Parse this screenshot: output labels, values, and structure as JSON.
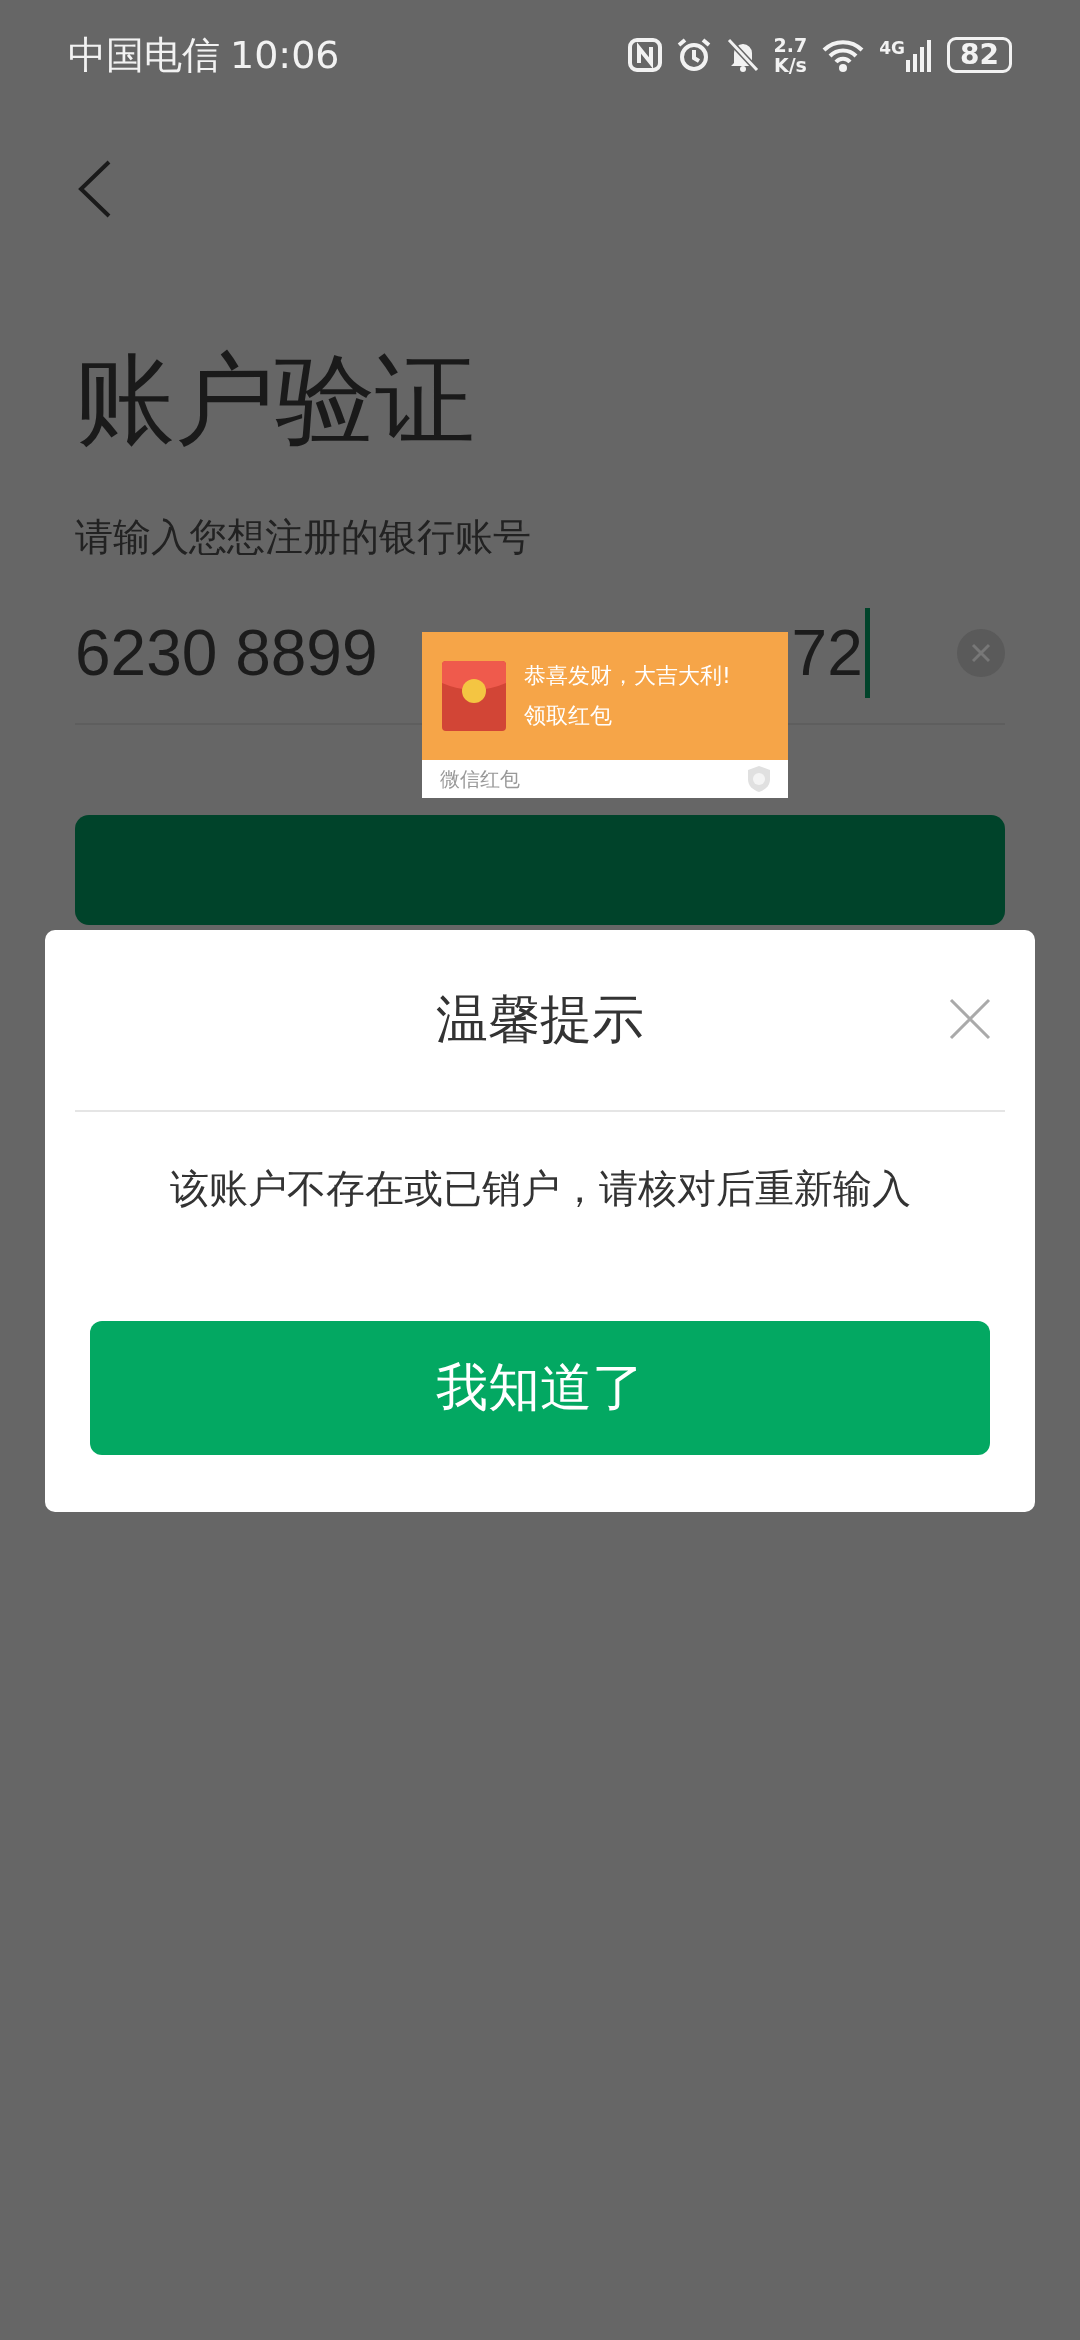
{
  "status_bar": {
    "carrier": "中国电信",
    "time": "10:06",
    "speed_value": "2.7",
    "speed_unit": "K/s",
    "network": "4G",
    "battery": "82"
  },
  "page": {
    "title": "账户验证",
    "subtitle": "请输入您想注册的银行账号",
    "account_visible_start": "6230 8899",
    "account_visible_end": "72"
  },
  "notification": {
    "title": "恭喜发财，大吉大利!",
    "action": "领取红包",
    "source": "微信红包"
  },
  "dialog": {
    "title": "温馨提示",
    "message": "该账户不存在或已销户，请核对后重新输入",
    "confirm": "我知道了"
  }
}
